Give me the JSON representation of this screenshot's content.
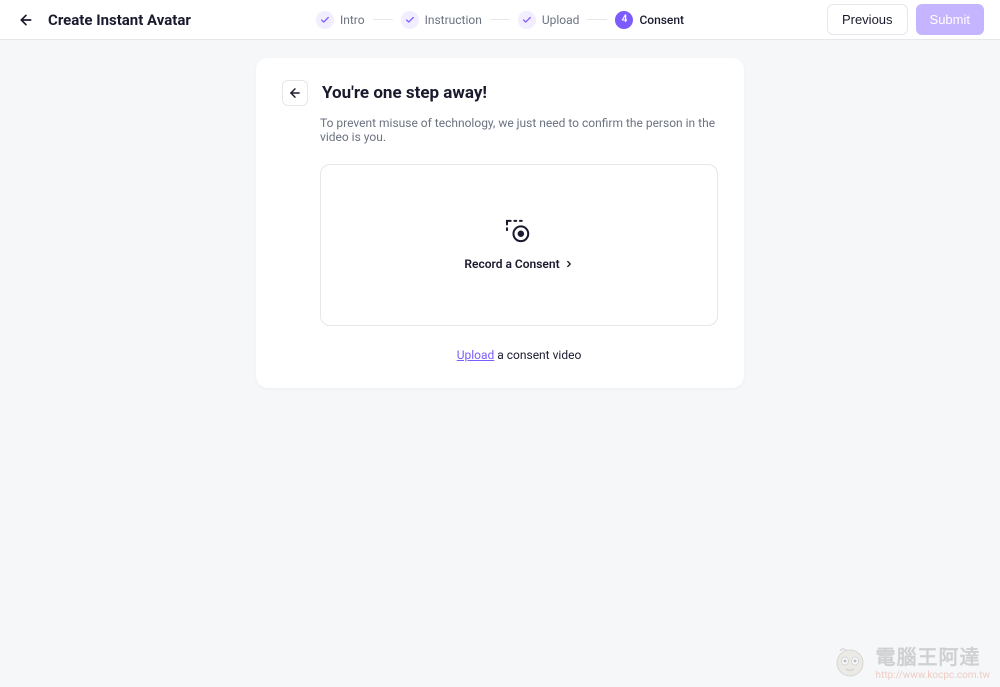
{
  "header": {
    "title": "Create Instant Avatar",
    "steps": [
      {
        "label": "Intro",
        "state": "completed"
      },
      {
        "label": "Instruction",
        "state": "completed"
      },
      {
        "label": "Upload",
        "state": "completed"
      },
      {
        "label": "Consent",
        "state": "active",
        "number": "4"
      }
    ],
    "previous_label": "Previous",
    "submit_label": "Submit"
  },
  "card": {
    "title": "You're one step away!",
    "subtitle": "To prevent misuse of technology, we just need to confirm the person in the video is you.",
    "record_label": "Record a Consent",
    "upload_link": "Upload",
    "upload_suffix": " a consent video"
  },
  "watermark": {
    "main": "電腦王阿達",
    "sub": "http://www.kocpc.com.tw"
  },
  "colors": {
    "primary": "#7c5cff",
    "primary_light": "#c5b4ff",
    "primary_bg": "#f2edff"
  }
}
